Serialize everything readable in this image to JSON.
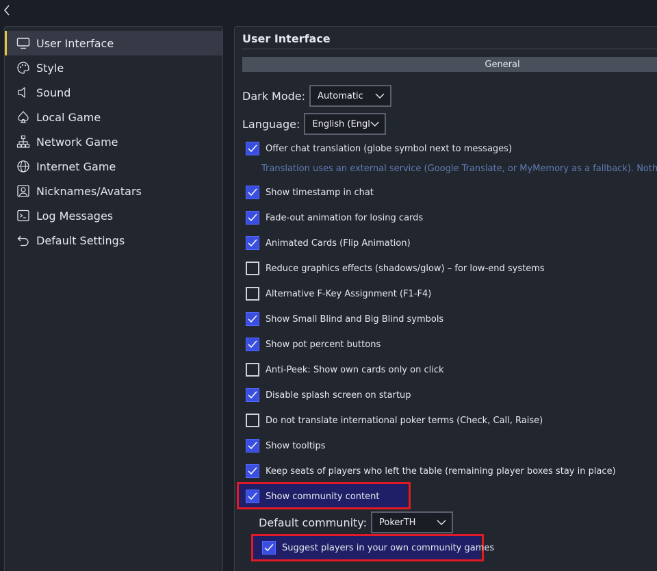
{
  "window": {
    "back_icon": "chevron-left-icon"
  },
  "sidebar": {
    "items": [
      {
        "label": "User Interface",
        "icon": "monitor-icon",
        "active": true
      },
      {
        "label": "Style",
        "icon": "palette-icon"
      },
      {
        "label": "Sound",
        "icon": "speaker-icon"
      },
      {
        "label": "Local Game",
        "icon": "spade-icon"
      },
      {
        "label": "Network Game",
        "icon": "network-icon"
      },
      {
        "label": "Internet Game",
        "icon": "globe-icon"
      },
      {
        "label": "Nicknames/Avatars",
        "icon": "avatar-icon"
      },
      {
        "label": "Log Messages",
        "icon": "terminal-icon"
      },
      {
        "label": "Default Settings",
        "icon": "undo-icon"
      }
    ]
  },
  "panel": {
    "title": "User Interface",
    "group": "General",
    "dark_mode": {
      "label": "Dark Mode:",
      "value": "Automatic"
    },
    "language": {
      "label": "Language:",
      "value": "English (Engli"
    },
    "translation_hint": "Translation uses an external service (Google Translate, or MyMemory as a fallback). Nothing is s",
    "options": [
      {
        "label": "Offer chat translation (globe symbol next to messages)",
        "checked": true
      },
      {
        "label": "Show timestamp in chat",
        "checked": true
      },
      {
        "label": "Fade-out animation for losing cards",
        "checked": true
      },
      {
        "label": "Animated Cards (Flip Animation)",
        "checked": true
      },
      {
        "label": "Reduce graphics effects (shadows/glow) – for low-end systems",
        "checked": false
      },
      {
        "label": "Alternative F-Key Assignment (F1-F4)",
        "checked": false
      },
      {
        "label": "Show Small Blind and Big Blind symbols",
        "checked": true
      },
      {
        "label": "Show pot percent buttons",
        "checked": true
      },
      {
        "label": "Anti-Peek: Show own cards only on click",
        "checked": false
      },
      {
        "label": "Disable splash screen on startup",
        "checked": true
      },
      {
        "label": "Do not translate international poker terms (Check, Call, Raise)",
        "checked": false
      },
      {
        "label": "Show tooltips",
        "checked": true
      },
      {
        "label": "Keep seats of players who left the table (remaining player boxes stay in place)",
        "checked": true
      },
      {
        "label": "Show community content",
        "checked": true
      }
    ],
    "default_community": {
      "label": "Default community:",
      "value": "PokerTH"
    },
    "suggest_players": {
      "label": "Suggest players in your own community games",
      "checked": true
    }
  },
  "colors": {
    "accent": "#3a4fe0",
    "active_marker": "#e8c33a",
    "highlight_border": "#e21a25",
    "hint_text": "#5f7db4"
  }
}
